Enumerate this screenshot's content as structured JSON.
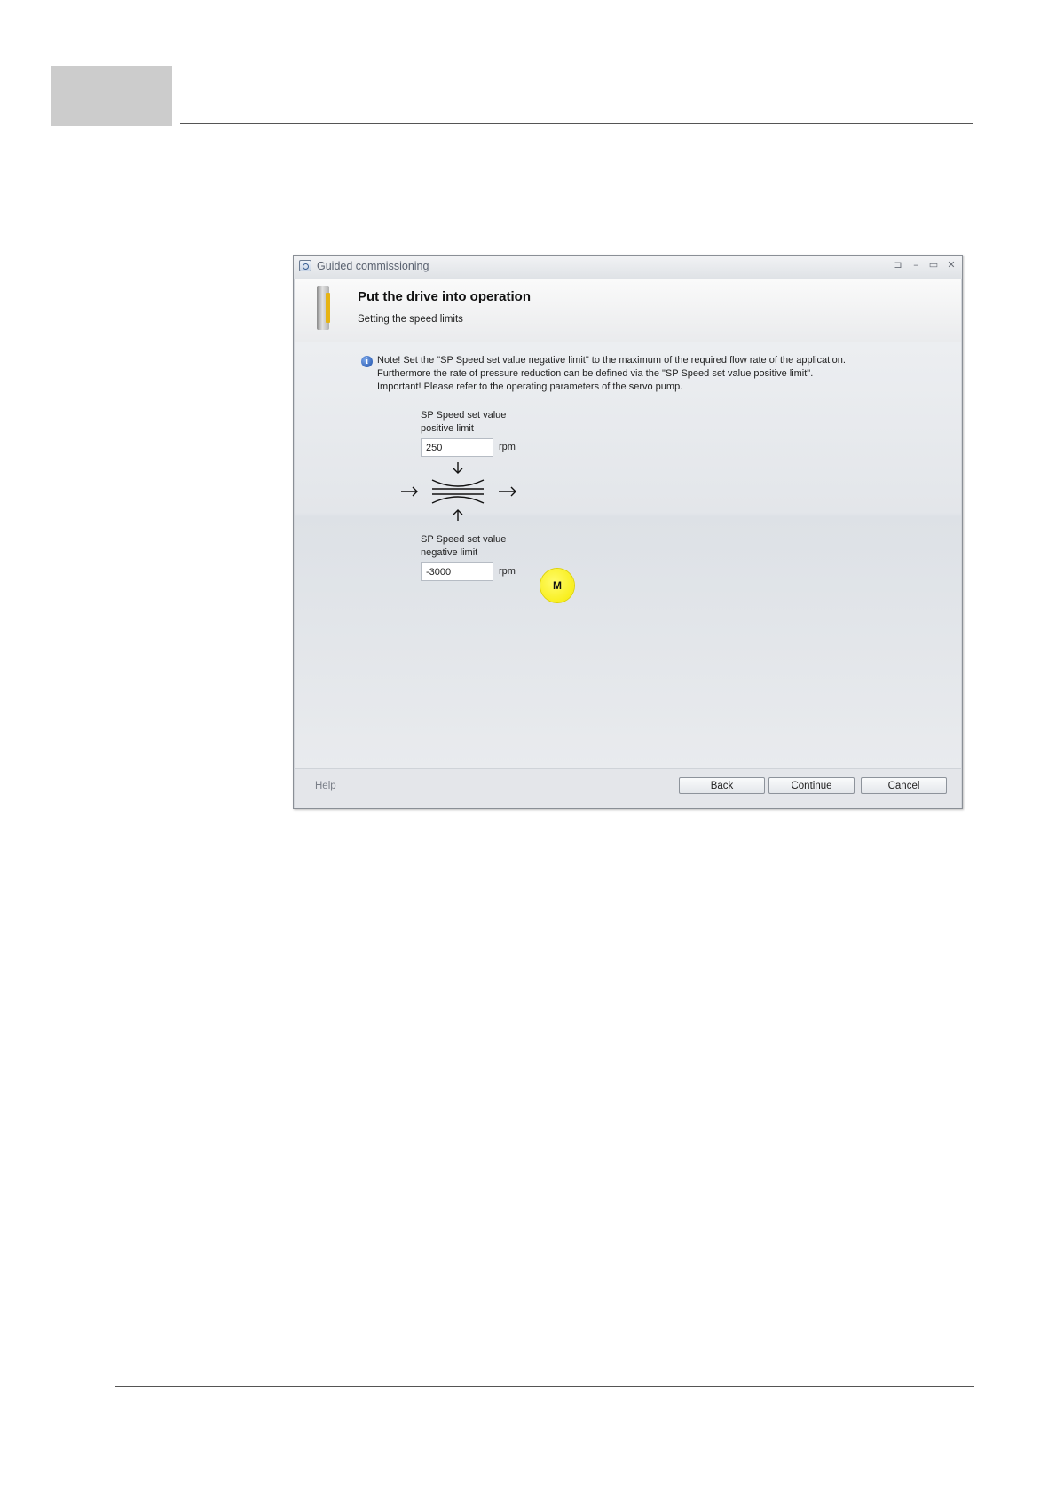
{
  "window": {
    "title": "Guided commissioning",
    "controls": {
      "pin": "⊐",
      "minimize": "–",
      "maximize": "▭",
      "close": "✕"
    }
  },
  "header": {
    "title": "Put the drive into operation",
    "subtitle": "Setting the speed limits"
  },
  "note": {
    "line1": "Note! Set the \"SP Speed set value negative limit\" to the maximum of the required flow rate of the application.",
    "line2": "Furthermore the rate of pressure reduction can be defined via the \"SP Speed set value positive limit\".",
    "line3": "Important! Please refer to the operating parameters of the servo pump."
  },
  "positive_limit": {
    "label_line1": "SP Speed set value",
    "label_line2": "positive limit",
    "value": "250",
    "unit": "rpm"
  },
  "negative_limit": {
    "label_line1": "SP Speed set value",
    "label_line2": "negative limit",
    "value": "-3000",
    "unit": "rpm"
  },
  "diagram": {
    "motor_label": "M",
    "motor_color": "#f6ea00"
  },
  "footer": {
    "help": "Help",
    "back": "Back",
    "continue": "Continue",
    "cancel": "Cancel"
  }
}
